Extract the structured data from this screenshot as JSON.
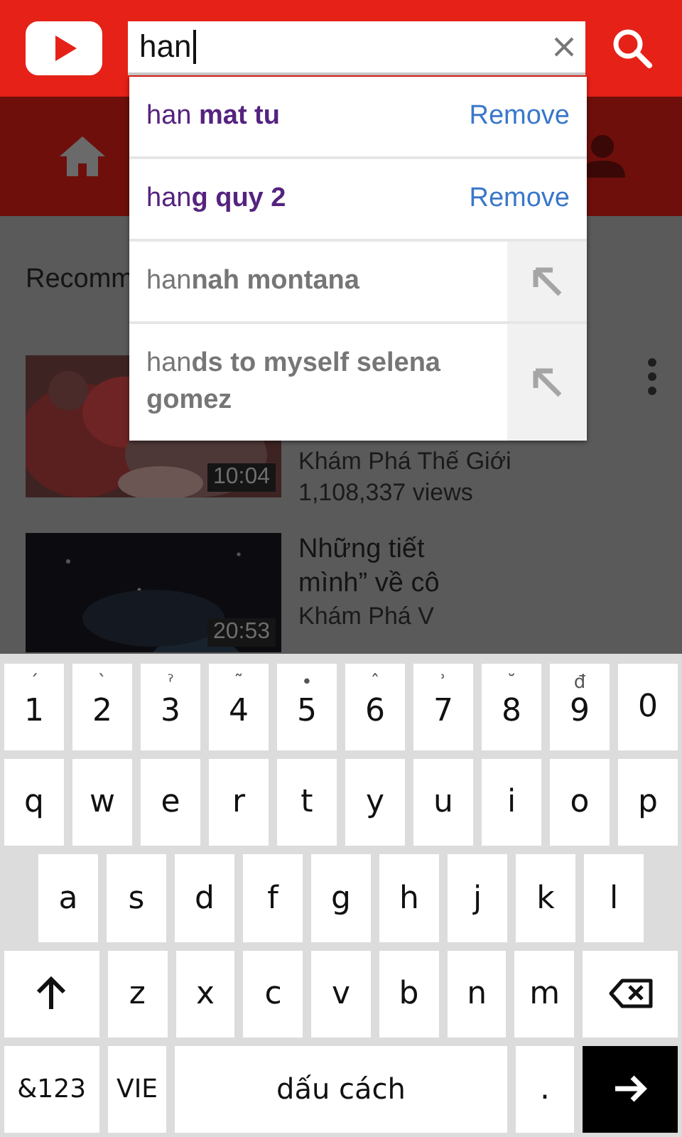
{
  "header": {
    "search": {
      "value": "han"
    }
  },
  "suggestions": [
    {
      "kind": "history",
      "text": "han **mat tu**",
      "action": "Remove"
    },
    {
      "kind": "history",
      "text": "han**g quy 2**",
      "action": "Remove"
    },
    {
      "kind": "query",
      "text": "han**nah montana**"
    },
    {
      "kind": "query",
      "text": "han**ds to myself selena gomez**"
    }
  ],
  "feed": {
    "section_title": "Recomm",
    "videos": [
      {
        "duration": "10:04",
        "channel": "Khám Phá Thế Giới",
        "views": "1,108,337 views"
      },
      {
        "duration": "20:53",
        "title_lines": [
          "Những tiết",
          "mình” về cô"
        ],
        "channel": "Khám Phá V"
      }
    ]
  },
  "keyboard": {
    "rows": [
      {
        "keys": [
          {
            "kind": "char",
            "label": "1",
            "hint": "´"
          },
          {
            "kind": "char",
            "label": "2",
            "hint": "`"
          },
          {
            "kind": "char",
            "label": "3",
            "hint": "ˀ"
          },
          {
            "kind": "char",
            "label": "4",
            "hint": "˜"
          },
          {
            "kind": "char",
            "label": "5",
            "hint": "•"
          },
          {
            "kind": "char",
            "label": "6",
            "hint": "ˆ"
          },
          {
            "kind": "char",
            "label": "7",
            "hint": "ʾ"
          },
          {
            "kind": "char",
            "label": "8",
            "hint": "˘"
          },
          {
            "kind": "char",
            "label": "9",
            "hint": "đ"
          },
          {
            "kind": "char",
            "label": "0"
          }
        ]
      },
      {
        "keys": [
          {
            "kind": "char",
            "label": "q"
          },
          {
            "kind": "char",
            "label": "w"
          },
          {
            "kind": "char",
            "label": "e"
          },
          {
            "kind": "char",
            "label": "r"
          },
          {
            "kind": "char",
            "label": "t"
          },
          {
            "kind": "char",
            "label": "y"
          },
          {
            "kind": "char",
            "label": "u"
          },
          {
            "kind": "char",
            "label": "i"
          },
          {
            "kind": "char",
            "label": "o"
          },
          {
            "kind": "char",
            "label": "p"
          }
        ]
      },
      {
        "keys": [
          {
            "kind": "char",
            "label": "a"
          },
          {
            "kind": "char",
            "label": "s"
          },
          {
            "kind": "char",
            "label": "d"
          },
          {
            "kind": "char",
            "label": "f"
          },
          {
            "kind": "char",
            "label": "g"
          },
          {
            "kind": "char",
            "label": "h"
          },
          {
            "kind": "char",
            "label": "j"
          },
          {
            "kind": "char",
            "label": "k"
          },
          {
            "kind": "char",
            "label": "l"
          }
        ]
      },
      {
        "keys": [
          {
            "kind": "shift"
          },
          {
            "kind": "char",
            "label": "z"
          },
          {
            "kind": "char",
            "label": "x"
          },
          {
            "kind": "char",
            "label": "c"
          },
          {
            "kind": "char",
            "label": "v"
          },
          {
            "kind": "char",
            "label": "b"
          },
          {
            "kind": "char",
            "label": "n"
          },
          {
            "kind": "char",
            "label": "m"
          },
          {
            "kind": "backspace"
          }
        ]
      },
      {
        "keys": [
          {
            "kind": "symbols",
            "label": "&123"
          },
          {
            "kind": "language",
            "label": "VIE"
          },
          {
            "kind": "space",
            "label": "dấu cách"
          },
          {
            "kind": "char",
            "label": "."
          },
          {
            "kind": "enter"
          }
        ]
      }
    ]
  }
}
